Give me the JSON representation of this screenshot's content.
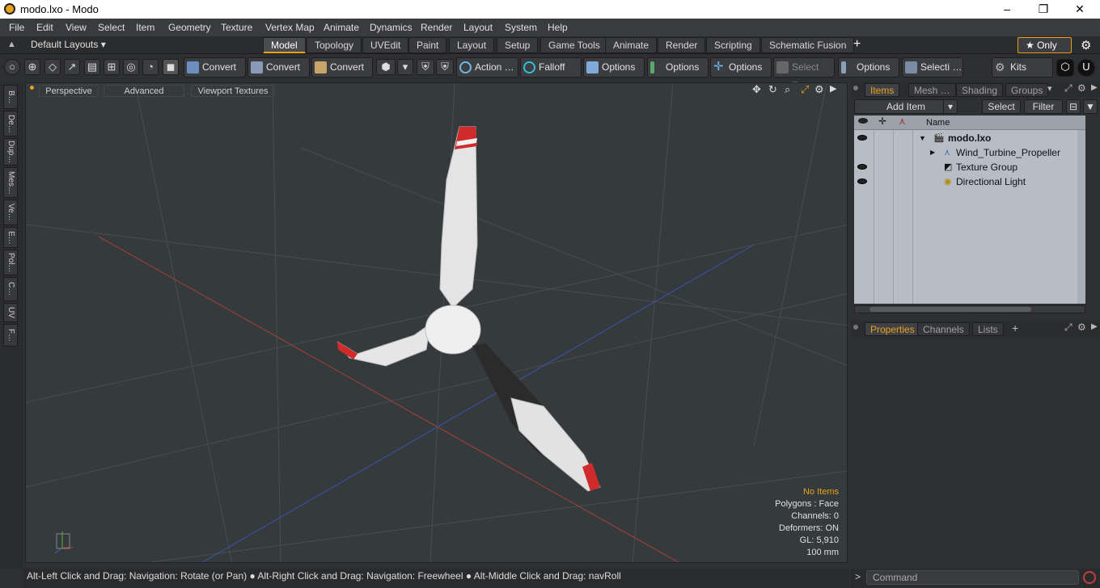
{
  "window": {
    "title": "modo.lxo - Modo",
    "minimize": "–",
    "maximize": "❐",
    "close": "✕"
  },
  "menu": [
    "File",
    "Edit",
    "View",
    "Select",
    "Item",
    "Geometry",
    "Texture",
    "Vertex Map",
    "Animate",
    "Dynamics",
    "Render",
    "Layout",
    "System",
    "Help"
  ],
  "layout_select": "Default Layouts ▾",
  "tabs": [
    "Model",
    "Topology",
    "UVEdit",
    "Paint",
    "Layout",
    "Setup",
    "Game Tools",
    "Animate",
    "Render",
    "Scripting",
    "Schematic Fusion"
  ],
  "tab_add": "+",
  "only_label": "★  Only",
  "toolbar": {
    "convert1": "Convert",
    "convert2": "Convert",
    "convert3": "Convert",
    "action": "Action  …",
    "falloff": "Falloff",
    "options1": "Options",
    "options2": "Options",
    "options3": "Options",
    "select_t": "Select T…",
    "options4": "Options",
    "selecti": "Selecti …",
    "kits": "Kits"
  },
  "left_tabs": [
    "B…",
    "De…",
    "Dup…",
    "Mes…",
    "Ve…",
    "E…",
    "Pol…",
    "C…",
    "UV",
    "F…"
  ],
  "viewport": {
    "buttons": [
      "Perspective",
      "Advanced",
      "Viewport Textures"
    ],
    "info": {
      "no_items": "No Items",
      "polygons": "Polygons : Face",
      "channels": "Channels: 0",
      "deformers": "Deformers: ON",
      "gl": "GL: 5,910",
      "scale": "100 mm"
    }
  },
  "status_text": "Alt-Left Click and Drag: Navigation: Rotate (or Pan) ● Alt-Right Click and Drag: Navigation: Freewheel ● Alt-Middle Click and Drag: navRoll",
  "right_panel": {
    "tabs": [
      "Items",
      "Mesh …",
      "Shading",
      "Groups"
    ],
    "add_item": "Add Item",
    "select": "Select",
    "filter": "Filter",
    "name_header": "Name",
    "tree": [
      {
        "label": "modo.lxo",
        "visible": true
      },
      {
        "label": "Wind_Turbine_Propeller",
        "visible": false
      },
      {
        "label": "Texture Group",
        "visible": true
      },
      {
        "label": "Directional Light",
        "visible": true
      }
    ],
    "prop_tabs": [
      "Properties",
      "Channels",
      "Lists"
    ],
    "prop_add": "+"
  },
  "command_placeholder": "Command",
  "colors": {
    "accent": "#e8a11b",
    "viewport_bg": "#353a3d",
    "tree_bg": "#b7bdc4"
  }
}
